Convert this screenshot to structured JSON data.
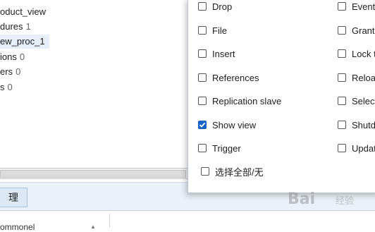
{
  "tree": {
    "items": [
      {
        "label": "oduct_view",
        "count": ""
      },
      {
        "label": "dures",
        "count": "1"
      },
      {
        "label": "ew_proc_1",
        "count": ""
      },
      {
        "label": "ions",
        "count": "0"
      },
      {
        "label": "ers",
        "count": "0"
      },
      {
        "label": "s",
        "count": "0"
      }
    ]
  },
  "bottom": {
    "tab_label": "理",
    "lower_text": "ommonel"
  },
  "privileges": {
    "left": [
      {
        "label": "Drop",
        "checked": false
      },
      {
        "label": "File",
        "checked": false
      },
      {
        "label": "Insert",
        "checked": false
      },
      {
        "label": "References",
        "checked": false
      },
      {
        "label": "Replication slave",
        "checked": false
      },
      {
        "label": "Show view",
        "checked": true
      },
      {
        "label": "Trigger",
        "checked": false
      }
    ],
    "right": [
      {
        "label": "Event",
        "checked": false
      },
      {
        "label": "Grant",
        "checked": false
      },
      {
        "label": "Lock t",
        "checked": false
      },
      {
        "label": "Reload",
        "checked": false
      },
      {
        "label": "Select",
        "checked": false
      },
      {
        "label": "Shutd",
        "checked": false
      },
      {
        "label": "Updat",
        "checked": false
      }
    ],
    "select_all_label": "选择全部/无",
    "select_all_checked": false
  },
  "watermark": {
    "text": "Bai",
    "sub": "经验"
  },
  "colors": {
    "check_accent": "#1a63c6",
    "selection_bg": "#e6eefa",
    "bottom_bar_bg": "#eaf1f8"
  }
}
